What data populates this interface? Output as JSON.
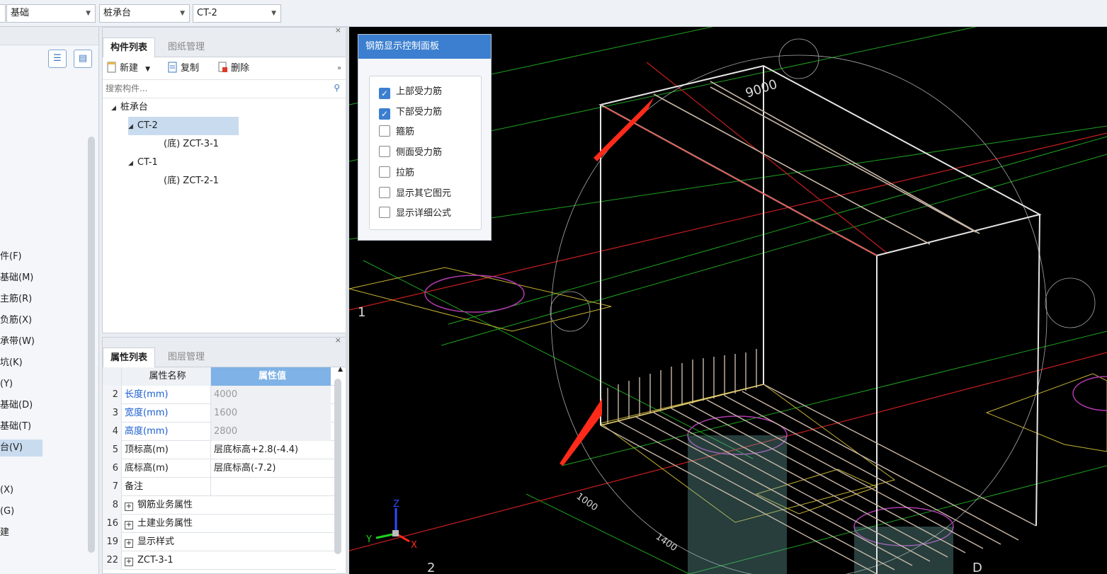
{
  "toolbar": {
    "floor_value": "基础",
    "category_value": "桩承台",
    "component_value": "CT-2"
  },
  "left_nav": {
    "items": [
      "件(F)",
      "基础(M)",
      "主筋(R)",
      "负筋(X)",
      "承带(W)",
      "坑(K)",
      "(Y)",
      "基础(D)",
      "基础(T)",
      "台(V)",
      "(X)",
      "(G)",
      "建"
    ],
    "selected_index": 9
  },
  "component_panel": {
    "tabs": [
      "构件列表",
      "图纸管理"
    ],
    "toolbar": {
      "new": "新建",
      "copy": "复制",
      "delete": "删除"
    },
    "search_placeholder": "搜索构件...",
    "tree": {
      "root": "桩承台",
      "nodes": [
        {
          "label": "CT-2",
          "child_prefix": "(底)",
          "child": "ZCT-3-1",
          "selected": true
        },
        {
          "label": "CT-1",
          "child_prefix": "(底)",
          "child": "ZCT-2-1",
          "selected": false
        }
      ]
    }
  },
  "property_panel": {
    "tabs": [
      "属性列表",
      "图层管理"
    ],
    "header": {
      "name": "属性名称",
      "value": "属性值"
    },
    "rows": [
      {
        "num": "2",
        "name": "长度(mm)",
        "value": "4000",
        "blue": true,
        "gray": true,
        "expand": false
      },
      {
        "num": "3",
        "name": "宽度(mm)",
        "value": "1600",
        "blue": true,
        "gray": true,
        "expand": false
      },
      {
        "num": "4",
        "name": "高度(mm)",
        "value": "2800",
        "blue": true,
        "gray": true,
        "expand": false
      },
      {
        "num": "5",
        "name": "顶标高(m)",
        "value": "层底标高+2.8(-4.4)",
        "blue": false,
        "gray": false,
        "expand": false
      },
      {
        "num": "6",
        "name": "底标高(m)",
        "value": "层底标高(-7.2)",
        "blue": false,
        "gray": false,
        "expand": false
      },
      {
        "num": "7",
        "name": "备注",
        "value": "",
        "blue": false,
        "gray": false,
        "expand": false
      },
      {
        "num": "8",
        "name": "钢筋业务属性",
        "value": "",
        "blue": false,
        "gray": false,
        "expand": true
      },
      {
        "num": "16",
        "name": "土建业务属性",
        "value": "",
        "blue": false,
        "gray": false,
        "expand": true
      },
      {
        "num": "19",
        "name": "显示样式",
        "value": "",
        "blue": false,
        "gray": false,
        "expand": true
      },
      {
        "num": "22",
        "name": "ZCT-3-1",
        "value": "",
        "blue": false,
        "gray": false,
        "expand": true
      }
    ]
  },
  "rebar_panel": {
    "title": "钢筋显示控制面板",
    "options": [
      {
        "label": "上部受力筋",
        "checked": true
      },
      {
        "label": "下部受力筋",
        "checked": true
      },
      {
        "label": "箍筋",
        "checked": false
      },
      {
        "label": "侧面受力筋",
        "checked": false
      },
      {
        "label": "拉筋",
        "checked": false
      },
      {
        "label": "显示其它图元",
        "checked": false
      },
      {
        "label": "显示详细公式",
        "checked": false
      }
    ]
  },
  "viewport": {
    "dimension_labels": [
      "9000",
      "1000",
      "1400"
    ],
    "axis_labels": [
      "1",
      "2",
      "D"
    ],
    "gizmo": {
      "x": "X",
      "y": "Y",
      "z": "Z"
    },
    "colors": {
      "background": "#000000",
      "grid_green": "#1fa21f",
      "grid_red": "#c81e1e",
      "outline_yellow": "#c8b432",
      "pile_magenta": "#b03ab0",
      "arrow_red": "#ff2a1a"
    }
  }
}
